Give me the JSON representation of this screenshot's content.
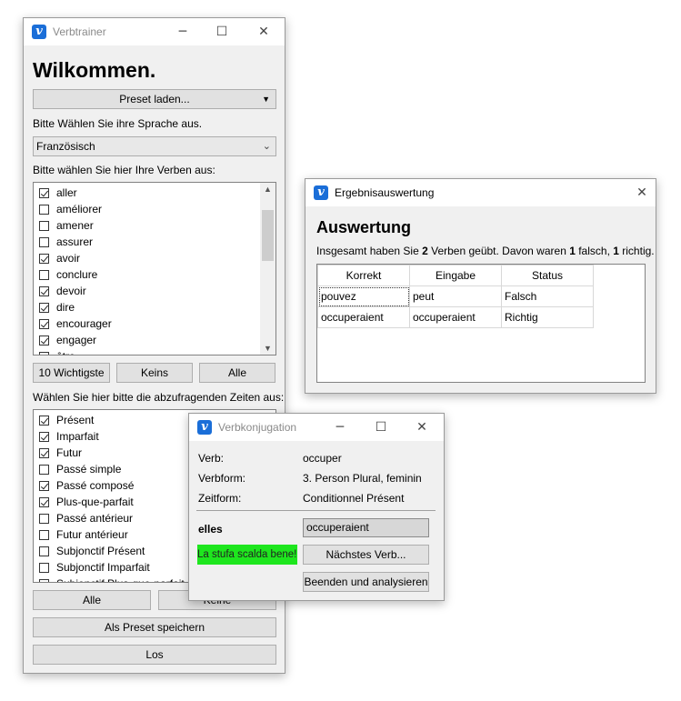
{
  "main": {
    "title": "Verbtrainer",
    "heading": "Wilkommen.",
    "preset_button": "Preset laden...",
    "language_prompt": "Bitte Wählen Sie ihre Sprache aus.",
    "language_selected": "Französisch",
    "verbs_prompt": "Bitte wählen Sie hier Ihre Verben aus:",
    "verbs": [
      {
        "label": "aller",
        "checked": true
      },
      {
        "label": "améliorer",
        "checked": false
      },
      {
        "label": "amener",
        "checked": false
      },
      {
        "label": "assurer",
        "checked": false
      },
      {
        "label": "avoir",
        "checked": true
      },
      {
        "label": "conclure",
        "checked": false
      },
      {
        "label": "devoir",
        "checked": true
      },
      {
        "label": "dire",
        "checked": true
      },
      {
        "label": "encourager",
        "checked": true
      },
      {
        "label": "engager",
        "checked": true
      },
      {
        "label": "être",
        "checked": false
      }
    ],
    "btn_top10": "10 Wichtigste",
    "btn_none": "Keins",
    "btn_all": "Alle",
    "tenses_prompt": "Wählen Sie hier bitte die abzufragenden Zeiten aus:",
    "tenses": [
      {
        "label": "Présent",
        "checked": true
      },
      {
        "label": "Imparfait",
        "checked": true
      },
      {
        "label": "Futur",
        "checked": true
      },
      {
        "label": "Passé simple",
        "checked": false
      },
      {
        "label": "Passé composé",
        "checked": true
      },
      {
        "label": "Plus-que-parfait",
        "checked": true
      },
      {
        "label": "Passé antérieur",
        "checked": false
      },
      {
        "label": "Futur antérieur",
        "checked": false
      },
      {
        "label": "Subjonctif Présent",
        "checked": false
      },
      {
        "label": "Subjonctif Imparfait",
        "checked": false
      },
      {
        "label": "Subjonctif Plus-que-parfait",
        "checked": false
      }
    ],
    "btn_all2": "Alle",
    "btn_none2": "Keine",
    "btn_save_preset": "Als Preset speichern",
    "btn_go": "Los"
  },
  "results": {
    "title": "Ergebnisauswertung",
    "heading": "Auswertung",
    "summary_prefix": "Insgesamt haben Sie ",
    "summary_count": "2",
    "summary_mid": " Verben geübt. Davon waren ",
    "summary_wrong": "1",
    "summary_wrong_word": " falsch, ",
    "summary_right": "1",
    "summary_right_word": " richtig.",
    "columns": [
      "Korrekt",
      "Eingabe",
      "Status"
    ],
    "rows": [
      {
        "korrekt": "pouvez",
        "eingabe": "peut",
        "status": "Falsch"
      },
      {
        "korrekt": "occuperaient",
        "eingabe": "occuperaient",
        "status": "Richtig"
      }
    ]
  },
  "conj": {
    "title": "Verbkonjugation",
    "verb_label": "Verb:",
    "verb_value": "occuper",
    "form_label": "Verbform:",
    "form_value": "3. Person Plural, feminin",
    "tense_label": "Zeitform:",
    "tense_value": "Conditionnel Présent",
    "pronoun": "elles",
    "answer": "occuperaient",
    "feedback": "La stufa scalda bene!",
    "feedback_color": "#1ee61e",
    "btn_next": "Nächstes Verb...",
    "btn_finish": "Beenden und analysieren"
  }
}
